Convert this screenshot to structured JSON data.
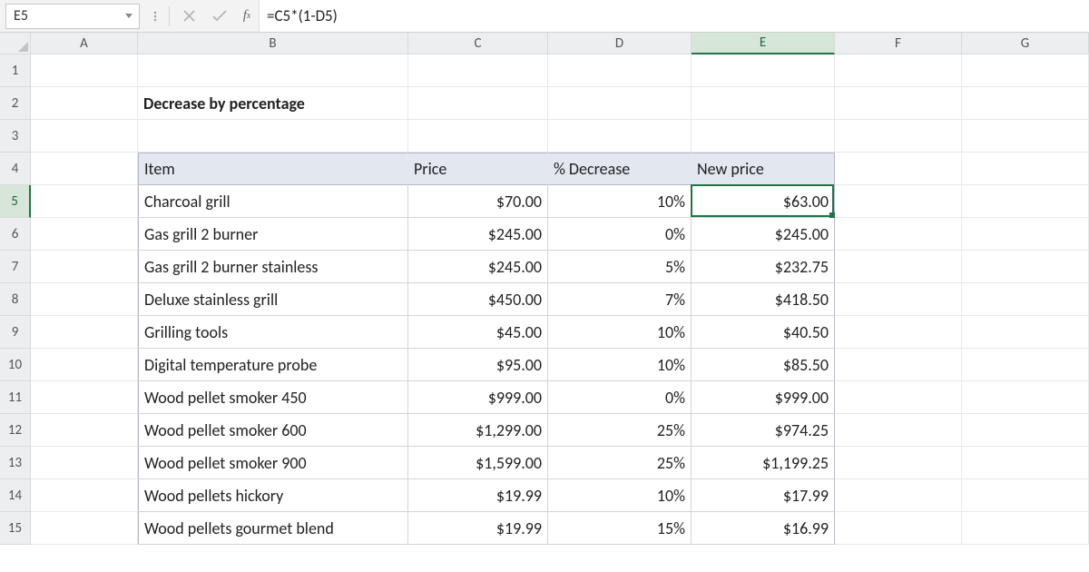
{
  "formula_bar": {
    "name_box": "E5",
    "formula": "=C5*(1-D5)"
  },
  "columns": [
    "A",
    "B",
    "C",
    "D",
    "E",
    "F",
    "G"
  ],
  "row_labels": [
    "1",
    "2",
    "3",
    "4",
    "5",
    "6",
    "7",
    "8",
    "9",
    "10",
    "11",
    "12",
    "13",
    "14",
    "15"
  ],
  "title": "Decrease by percentage",
  "headers": {
    "item": "Item",
    "price": "Price",
    "decrease": "% Decrease",
    "new_price": "New price"
  },
  "rows": [
    {
      "item": "Charcoal grill",
      "price": "$70.00",
      "pct": "10%",
      "nprice": "$63.00"
    },
    {
      "item": "Gas grill 2 burner",
      "price": "$245.00",
      "pct": "0%",
      "nprice": "$245.00"
    },
    {
      "item": "Gas grill 2 burner stainless",
      "price": "$245.00",
      "pct": "5%",
      "nprice": "$232.75"
    },
    {
      "item": "Deluxe stainless grill",
      "price": "$450.00",
      "pct": "7%",
      "nprice": "$418.50"
    },
    {
      "item": "Grilling tools",
      "price": "$45.00",
      "pct": "10%",
      "nprice": "$40.50"
    },
    {
      "item": "Digital temperature probe",
      "price": "$95.00",
      "pct": "10%",
      "nprice": "$85.50"
    },
    {
      "item": "Wood pellet smoker 450",
      "price": "$999.00",
      "pct": "0%",
      "nprice": "$999.00"
    },
    {
      "item": "Wood pellet smoker 600",
      "price": "$1,299.00",
      "pct": "25%",
      "nprice": "$974.25"
    },
    {
      "item": "Wood pellet smoker 900",
      "price": "$1,599.00",
      "pct": "25%",
      "nprice": "$1,199.25"
    },
    {
      "item": "Wood pellets hickory",
      "price": "$19.99",
      "pct": "10%",
      "nprice": "$17.99"
    },
    {
      "item": "Wood pellets gourmet blend",
      "price": "$19.99",
      "pct": "15%",
      "nprice": "$16.99"
    }
  ],
  "active_cell": "E5"
}
